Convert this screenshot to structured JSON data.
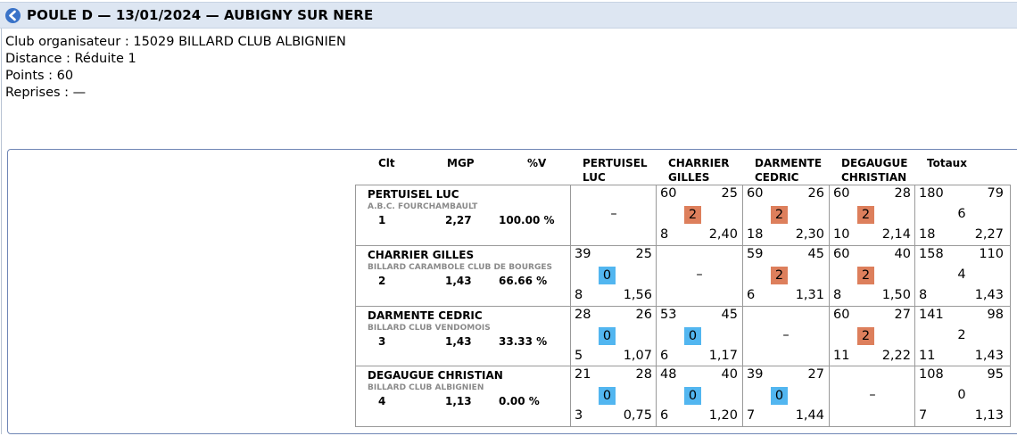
{
  "header": {
    "title": "POULE D — 13/01/2024 — AUBIGNY SUR NERE",
    "back_icon": "back-arrow-icon",
    "accent": "#3a73c8"
  },
  "info": {
    "organisateur": "Club organisateur : 15029 BILLARD CLUB ALBIGNIEN",
    "distance": "Distance : Réduite 1",
    "points": "Points : 60",
    "reprises": "Reprises : —"
  },
  "table": {
    "headers": {
      "clt": "Clt",
      "mgp": "MGP",
      "pv": "%V",
      "c1a": "PERTUISEL",
      "c1b": "LUC",
      "c2a": "CHARRIER",
      "c2b": "GILLES",
      "c3a": "DARMENTE",
      "c3b": "CEDRIC",
      "c4a": "DEGAUGUE",
      "c4b": "CHRISTIAN",
      "totaux": "Totaux"
    },
    "colors": {
      "win": "#dd7f5c",
      "loss": "#52b6f0"
    },
    "rows": [
      {
        "name": "PERTUISEL LUC",
        "club": "A.B.C. FOURCHAMBAULT",
        "clt": "1",
        "mgp": "2,27",
        "pv": "100.00 %",
        "cells": [
          {
            "self": true,
            "dash": "–"
          },
          {
            "pts": "60",
            "opp": "25",
            "score": "2",
            "result": "win",
            "rep": "8",
            "avg": "2,40"
          },
          {
            "pts": "60",
            "opp": "26",
            "score": "2",
            "result": "win",
            "rep": "18",
            "avg": "2,30"
          },
          {
            "pts": "60",
            "opp": "28",
            "score": "2",
            "result": "win",
            "rep": "10",
            "avg": "2,14"
          }
        ],
        "totals": {
          "pts": "180",
          "opp": "79",
          "score": "6",
          "rep": "18",
          "avg": "2,27"
        }
      },
      {
        "name": "CHARRIER GILLES",
        "club": "BILLARD CARAMBOLE CLUB DE BOURGES",
        "clt": "2",
        "mgp": "1,43",
        "pv": "66.66 %",
        "cells": [
          {
            "pts": "39",
            "opp": "25",
            "score": "0",
            "result": "loss",
            "rep": "8",
            "avg": "1,56"
          },
          {
            "self": true,
            "dash": "–"
          },
          {
            "pts": "59",
            "opp": "45",
            "score": "2",
            "result": "win",
            "rep": "6",
            "avg": "1,31"
          },
          {
            "pts": "60",
            "opp": "40",
            "score": "2",
            "result": "win",
            "rep": "8",
            "avg": "1,50"
          }
        ],
        "totals": {
          "pts": "158",
          "opp": "110",
          "score": "4",
          "rep": "8",
          "avg": "1,43"
        }
      },
      {
        "name": "DARMENTE CEDRIC",
        "club": "BILLARD CLUB VENDOMOIS",
        "clt": "3",
        "mgp": "1,43",
        "pv": "33.33 %",
        "cells": [
          {
            "pts": "28",
            "opp": "26",
            "score": "0",
            "result": "loss",
            "rep": "5",
            "avg": "1,07"
          },
          {
            "pts": "53",
            "opp": "45",
            "score": "0",
            "result": "loss",
            "rep": "6",
            "avg": "1,17"
          },
          {
            "self": true,
            "dash": "–"
          },
          {
            "pts": "60",
            "opp": "27",
            "score": "2",
            "result": "win",
            "rep": "11",
            "avg": "2,22"
          }
        ],
        "totals": {
          "pts": "141",
          "opp": "98",
          "score": "2",
          "rep": "11",
          "avg": "1,43"
        }
      },
      {
        "name": "DEGAUGUE CHRISTIAN",
        "club": "BILLARD CLUB ALBIGNIEN",
        "clt": "4",
        "mgp": "1,13",
        "pv": "0.00 %",
        "cells": [
          {
            "pts": "21",
            "opp": "28",
            "score": "0",
            "result": "loss",
            "rep": "3",
            "avg": "0,75"
          },
          {
            "pts": "48",
            "opp": "40",
            "score": "0",
            "result": "loss",
            "rep": "6",
            "avg": "1,20"
          },
          {
            "pts": "39",
            "opp": "27",
            "score": "0",
            "result": "loss",
            "rep": "7",
            "avg": "1,44"
          },
          {
            "self": true,
            "dash": "–"
          }
        ],
        "totals": {
          "pts": "108",
          "opp": "95",
          "score": "0",
          "rep": "7",
          "avg": "1,13"
        }
      }
    ]
  }
}
